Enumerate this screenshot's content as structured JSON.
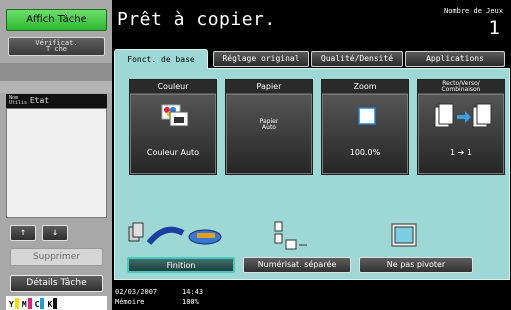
{
  "left": {
    "affich_tache": "Affich Tâche",
    "verificat": "Vérificat.",
    "verificat_sub": "T che",
    "job_header_nom": "Nom",
    "job_header_utilis": "Utilis",
    "job_header_etat": "Etat",
    "arrow_up": "↑",
    "arrow_down": "↓",
    "supprimer": "Supprimer",
    "details_tache": "Détails Tâche",
    "toners": [
      {
        "letter": "Y",
        "color": "#f2e200"
      },
      {
        "letter": "M",
        "color": "#e0207a"
      },
      {
        "letter": "C",
        "color": "#1aa0e0"
      },
      {
        "letter": "K",
        "color": "#111111"
      }
    ]
  },
  "header": {
    "title": "Prêt à copier.",
    "copies_label": "Nombre de Jeux",
    "copies_value": "1"
  },
  "tabs": {
    "fonct_de_base": "Fonct. de base",
    "reglage_original": "Réglage original",
    "qualite_densite": "Qualité/Densité",
    "applications": "Applications"
  },
  "cards": {
    "couleur": {
      "label": "Couleur",
      "value": "Couleur Auto"
    },
    "papier": {
      "label": "Papier",
      "value_line1": "Papier",
      "value_line2": "Auto"
    },
    "zoom": {
      "label": "Zoom",
      "value": "100.0%"
    },
    "recto": {
      "label_line1": "Recto/Verso/",
      "label_line2": "Combinaison",
      "value": "1 ➜ 1"
    }
  },
  "options": {
    "finition": "Finition",
    "numerisat_separee": "Numérisat. séparée",
    "ne_pas_pivoter": "Ne pas pivoter"
  },
  "status": {
    "date": "02/03/2007",
    "time": "14:43",
    "memoire_label": "Mémoire",
    "memoire_value": "100%"
  },
  "colors": {
    "accent_green": "#2cb62c",
    "panel_teal": "#9ed8d5",
    "active_border": "#48c8b8"
  }
}
